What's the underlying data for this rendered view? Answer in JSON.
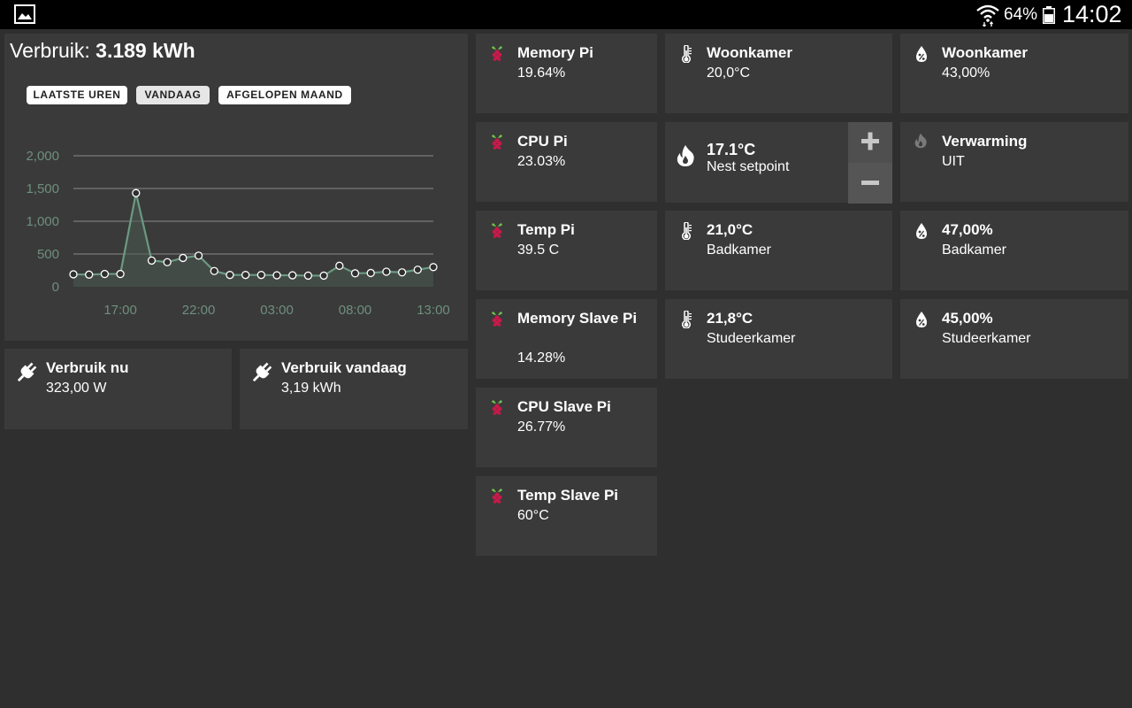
{
  "statusbar": {
    "battery_percent": "64%",
    "battery_level": 0.64,
    "clock": "14:02",
    "icons": [
      "gallery-icon",
      "wifi-icon",
      "battery-icon"
    ]
  },
  "energy": {
    "title_label": "Verbruik: ",
    "title_value": "3.189 kWh",
    "buttons": [
      "LAATSTE UREN",
      "VANDAAG",
      "AFGELOPEN MAAND"
    ],
    "active_button": "VANDAAG"
  },
  "chart_data": {
    "type": "area",
    "x_ticks": [
      "17:00",
      "22:00",
      "03:00",
      "08:00",
      "13:00"
    ],
    "y_ticks": [
      "0",
      "500",
      "1,000",
      "1,500",
      "2,000"
    ],
    "ylim": [
      0,
      2000
    ],
    "grid": true,
    "series": [
      {
        "values": [
          190,
          185,
          195,
          195,
          1430,
          400,
          375,
          440,
          475,
          240,
          180,
          180,
          180,
          175,
          175,
          170,
          170,
          320,
          205,
          210,
          230,
          220,
          260,
          300
        ]
      }
    ],
    "colors": {
      "line": "#6b9a82",
      "point_fill": "#2f2f2f",
      "point_stroke": "#ffffff",
      "axis_text": "#6e8f7e"
    }
  },
  "power_tiles": [
    {
      "label": "Verbruik nu",
      "value": "323,00 W",
      "icon": "plug-icon"
    },
    {
      "label": "Verbruik vandaag",
      "value": "3,19 kWh",
      "icon": "plug-icon"
    }
  ],
  "pi_tiles": [
    {
      "label": "Memory Pi",
      "value": "19.64%",
      "icon": "raspberry-pi-icon"
    },
    {
      "label": "CPU Pi",
      "value": "23.03%",
      "icon": "raspberry-pi-icon"
    },
    {
      "label": "Temp Pi",
      "value": "39.5 C",
      "icon": "raspberry-pi-icon"
    },
    {
      "label": "Memory Slave Pi",
      "value": "14.28%",
      "icon": "raspberry-pi-icon"
    },
    {
      "label": "CPU Slave Pi",
      "value": "26.77%",
      "icon": "raspberry-pi-icon"
    },
    {
      "label": "Temp Slave Pi",
      "value": "60°C",
      "icon": "raspberry-pi-icon"
    }
  ],
  "temperature_tiles": [
    {
      "label": "Woonkamer",
      "value": "20,0°C",
      "icon": "thermometer-icon"
    },
    {
      "label": "21,0°C",
      "value": "Badkamer",
      "icon": "thermometer-icon"
    },
    {
      "label": "21,8°C",
      "value": "Studeerkamer",
      "icon": "thermometer-icon"
    }
  ],
  "nest": {
    "temperature": "17.1°C",
    "label": "Nest setpoint",
    "icon": "flame-icon"
  },
  "humidity_tiles": [
    {
      "label": "Woonkamer",
      "value": "43,00%",
      "icon": "humidity-icon"
    },
    {
      "label": "47,00%",
      "value": "Badkamer",
      "icon": "humidity-icon"
    },
    {
      "label": "45,00%",
      "value": "Studeerkamer",
      "icon": "humidity-icon"
    }
  ],
  "heating": {
    "label": "Verwarming",
    "value": "UIT",
    "icon": "flame-icon"
  }
}
